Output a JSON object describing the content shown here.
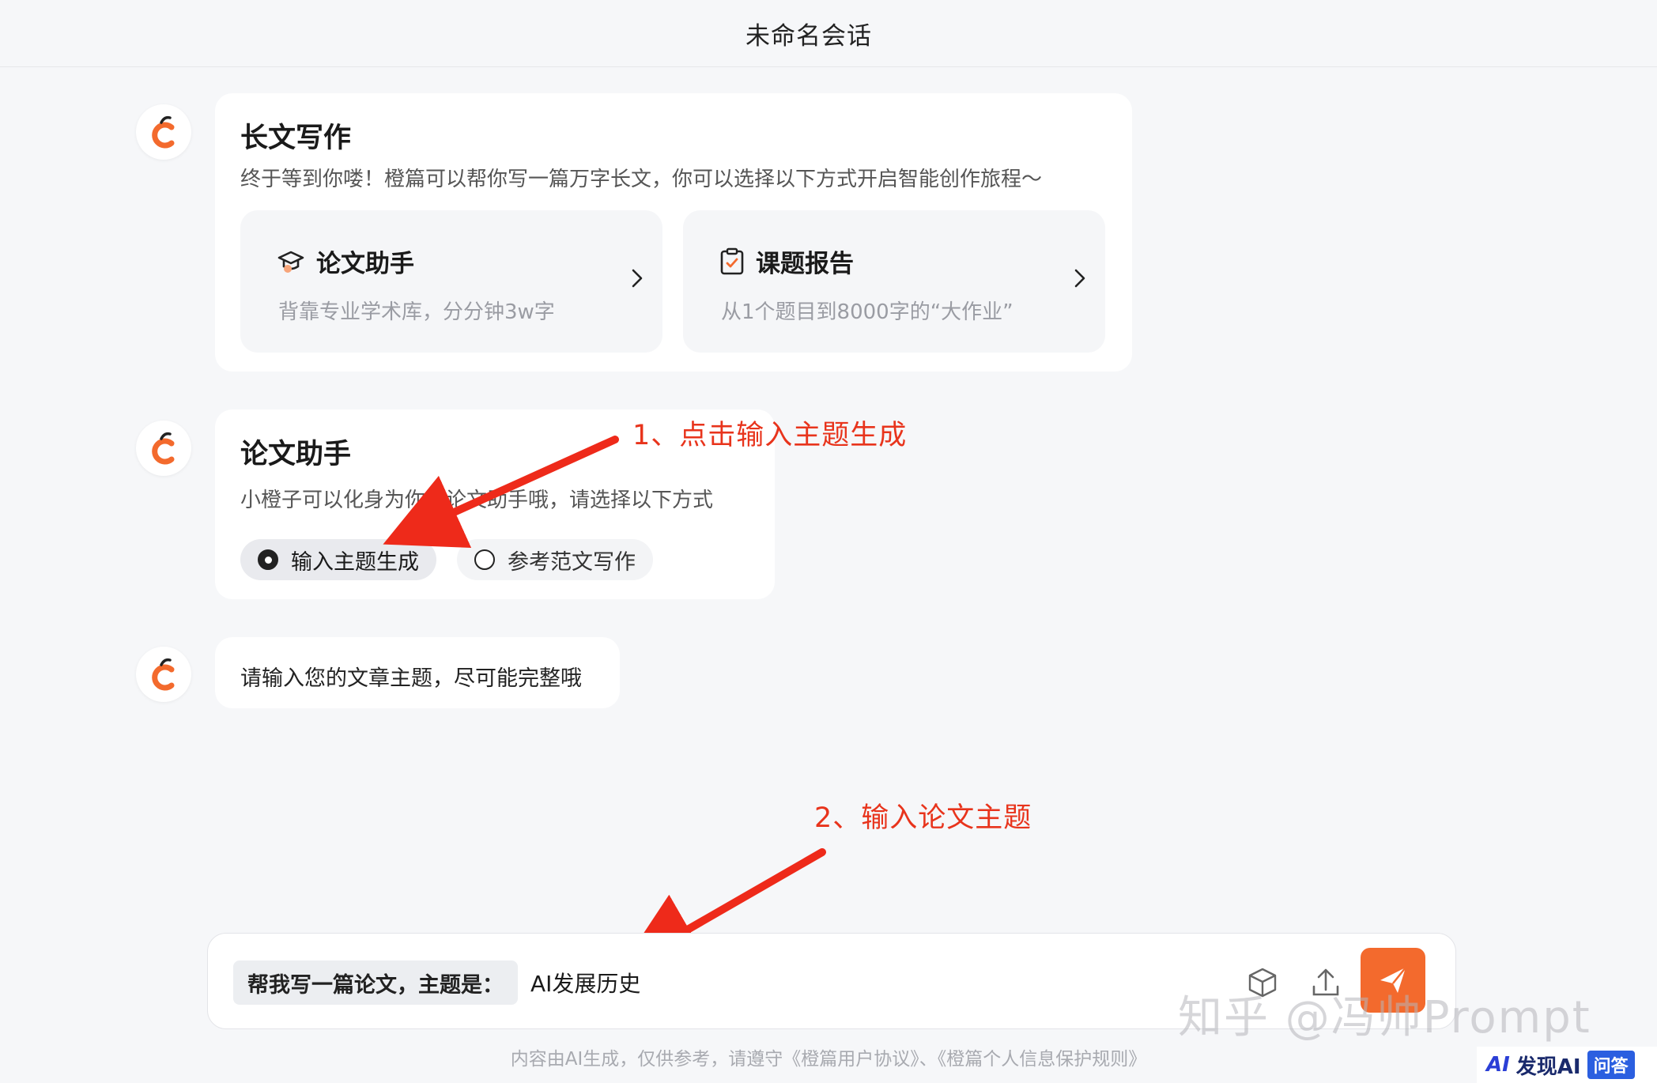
{
  "header": {
    "title": "未命名会话"
  },
  "long_writing_card": {
    "title": "长文写作",
    "desc": "终于等到你喽！橙篇可以帮你写一篇万字长文，你可以选择以下方式开启智能创作旅程～",
    "options": [
      {
        "icon": "graduation-cap-icon",
        "title": "论文助手",
        "sub": "背靠专业学术库，分分钟3w字"
      },
      {
        "icon": "clipboard-check-icon",
        "title": "课题报告",
        "sub": "从1个题目到8000字的“大作业”"
      }
    ]
  },
  "thesis_card": {
    "title": "论文助手",
    "desc": "小橙子可以化身为你的论文助手哦，请选择以下方式",
    "choices": [
      {
        "label": "输入主题生成",
        "selected": true
      },
      {
        "label": "参考范文写作",
        "selected": false
      }
    ]
  },
  "prompt_bubble": {
    "text": "请输入您的文章主题，尽可能完整哦"
  },
  "annotations": {
    "step1": "1、点击输入主题生成",
    "step2": "2、输入论文主题"
  },
  "composer": {
    "prefix": "帮我写一篇论文，主题是：",
    "value": "AI发展历史",
    "icons": [
      "cube-icon",
      "upload-icon",
      "send-icon"
    ]
  },
  "footer": {
    "note": "内容由AI生成，仅供参考，请遵守《橙篇用户协议》、《橙篇个人信息保护规则》"
  },
  "watermark": {
    "text": "知乎 @冯帅Prompt"
  },
  "badge": {
    "logo": "AI",
    "text": "发现AI",
    "chip": "问答"
  },
  "colors": {
    "accent": "#f36a2d",
    "annotation": "#e8341c",
    "background": "#f6f7f9"
  }
}
